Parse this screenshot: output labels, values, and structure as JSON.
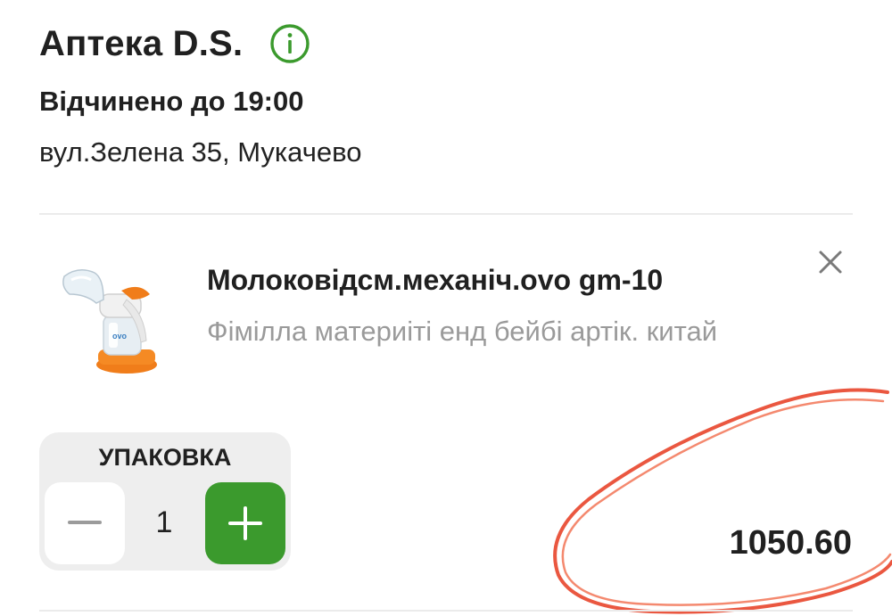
{
  "shop": {
    "name": "Аптека D.S.",
    "hours": "Відчинено до 19:00",
    "address": "вул.Зелена 35, Мукачево",
    "info_icon": "info-circle-icon"
  },
  "product": {
    "name": "Молоковідсм.механіч.ovo gm-10",
    "manufacturer": "Фімілла материіті енд бейбі артік. китай",
    "image_label": "ovo",
    "remove_icon": "close-icon"
  },
  "quantity": {
    "label": "УПАКОВКА",
    "value": "1",
    "minus_icon": "minus-icon",
    "plus_icon": "plus-icon"
  },
  "price": "1050.60",
  "colors": {
    "accent_green": "#3b9a2d",
    "annotation_red": "#e8452b",
    "muted_text": "#9a9a9a"
  }
}
